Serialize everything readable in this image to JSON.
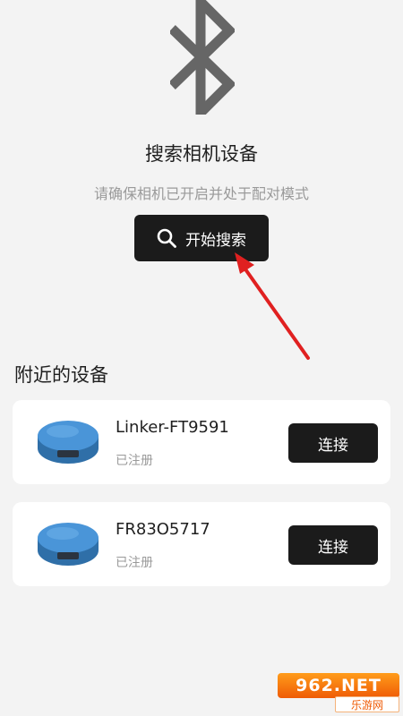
{
  "header": {
    "title": "搜索相机设备",
    "subtitle": "请确保相机已开启并处于配对模式",
    "search_button_label": "开始搜索",
    "icon": "bluetooth-icon"
  },
  "devices": {
    "section_title": "附近的设备",
    "items": [
      {
        "name": "Linker-FT9591",
        "status": "已注册",
        "connect_label": "连接"
      },
      {
        "name": "FR83O5717",
        "status": "已注册",
        "connect_label": "连接"
      }
    ]
  },
  "watermark": {
    "top_text": "962.NET",
    "bottom_text": "乐游网"
  },
  "colors": {
    "background": "#f3f3f3",
    "button_bg": "#1b1b1b",
    "annotation_arrow": "#e02020",
    "watermark_orange": "#ef5b06"
  }
}
